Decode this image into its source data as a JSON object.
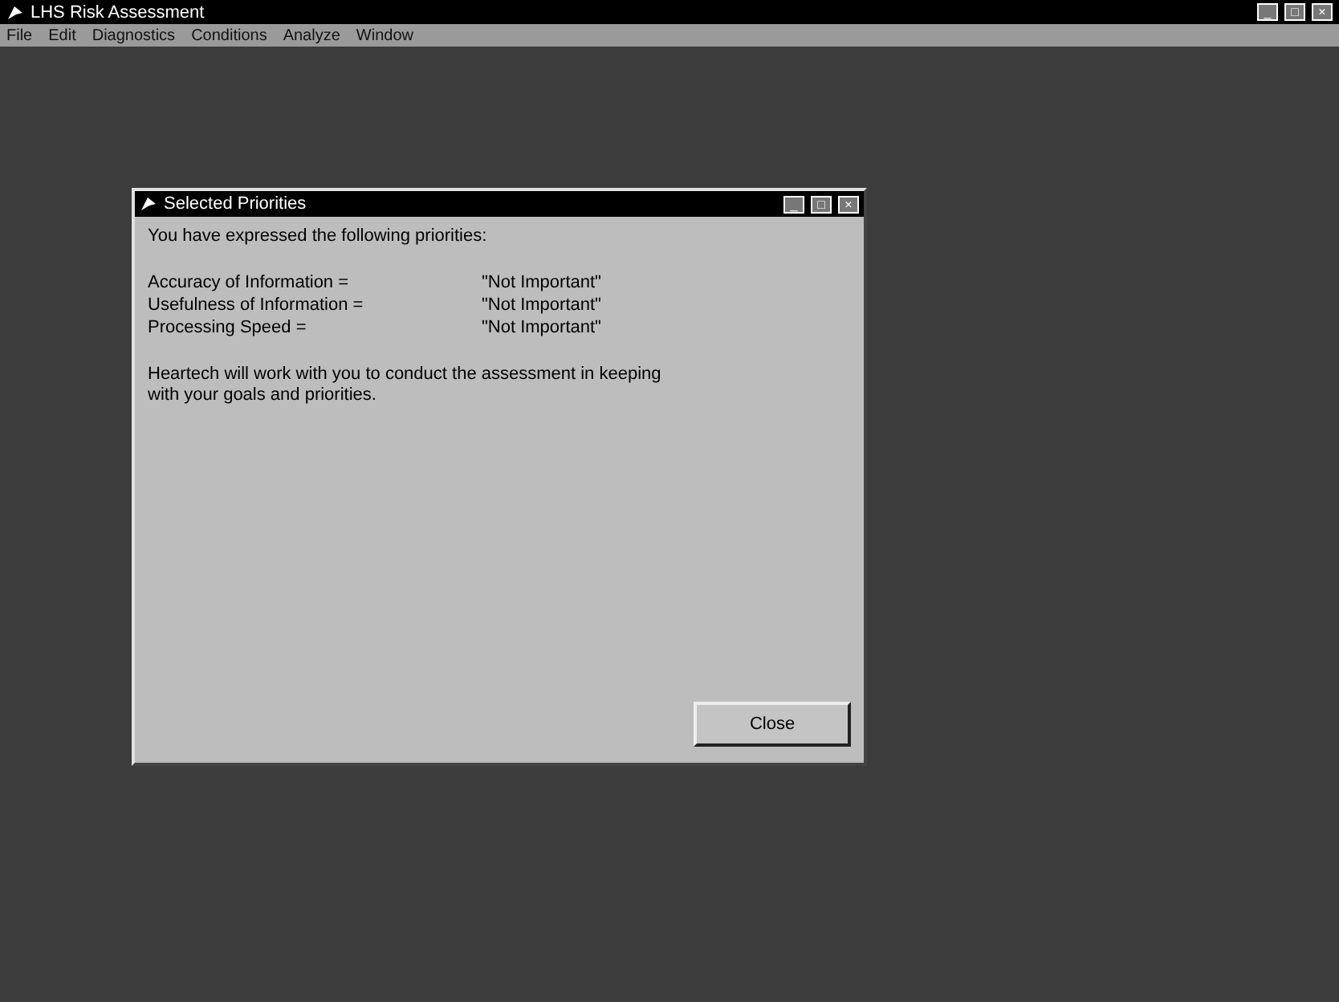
{
  "window": {
    "title": "LHS Risk Assessment",
    "controls": [
      "_",
      "□",
      "×"
    ]
  },
  "menu": [
    "File",
    "Edit",
    "Diagnostics",
    "Conditions",
    "Analyze",
    "Window"
  ],
  "dialog": {
    "title": "Selected Priorities",
    "controls": [
      "_",
      "□",
      "×"
    ],
    "intro": "You have expressed the following priorities:",
    "priorities": [
      {
        "label": "Accuracy of Information =",
        "value": "\"Not Important\""
      },
      {
        "label": "Usefulness of Information =",
        "value": "\"Not Important\""
      },
      {
        "label": "Processing Speed =",
        "value": "\"Not Important\""
      }
    ],
    "message": "Heartech will work with you to conduct the assessment in keeping with your goals and priorities.",
    "button": "Close"
  }
}
